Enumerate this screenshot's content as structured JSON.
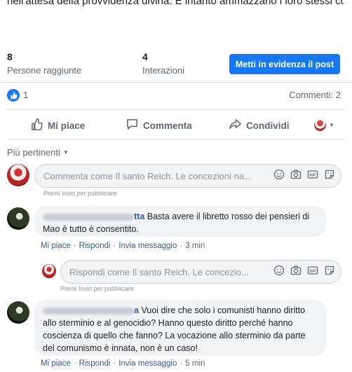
{
  "post": {
    "text": "nell'attesa della provvidenza divina. E intanto ammazzano i loro stessi concittadini."
  },
  "stats": {
    "reach_value": "8",
    "reach_label": "Persone raggiunte",
    "interactions_value": "4",
    "interactions_label": "Interazioni",
    "promote_label": "Metti in evidenza il post"
  },
  "reactions": {
    "count": "1",
    "comments_count": "Commenti: 2"
  },
  "actions": {
    "like": "Mi piace",
    "comment": "Commenta",
    "share": "Condividi"
  },
  "sort": {
    "label": "Più pertinenti"
  },
  "composer": {
    "placeholder": "Commenta come Il santo Reich. Le concezioni na...",
    "hint": "Premi Invio per pubblicare."
  },
  "comments": [
    {
      "author_visible": "tta",
      "text_line1": "Basta avere il libretto rosso dei pensieri di",
      "text_line2": "Mao è tutto è consentito.",
      "like": "Mi piace",
      "reply": "Rispondi",
      "message": "Invia messaggio",
      "time": "3 min"
    },
    {
      "author_visible": "a",
      "text_line1": "Vuoi dire che solo i comunisti hanno diritto",
      "text_line2": "allo sterminio e al genocidio? Hanno questo diritto perché hanno",
      "text_line3": "coscienza di quello che fanno? La vocazione allo sterminio da parte",
      "text_line4": "del comunismo è innata, non è un caso!",
      "like": "Mi piace",
      "reply": "Rispondi",
      "message": "Invia messaggio",
      "time": "5 min"
    }
  ],
  "reply_composer": {
    "placeholder": "Rispondi come Il santo Reich. Le concezio...",
    "hint": "Premi Invio per pubblicare."
  },
  "colors": {
    "accent": "#1877f2",
    "link": "#385898",
    "muted": "#606770",
    "bubble": "#f2f3f5"
  }
}
